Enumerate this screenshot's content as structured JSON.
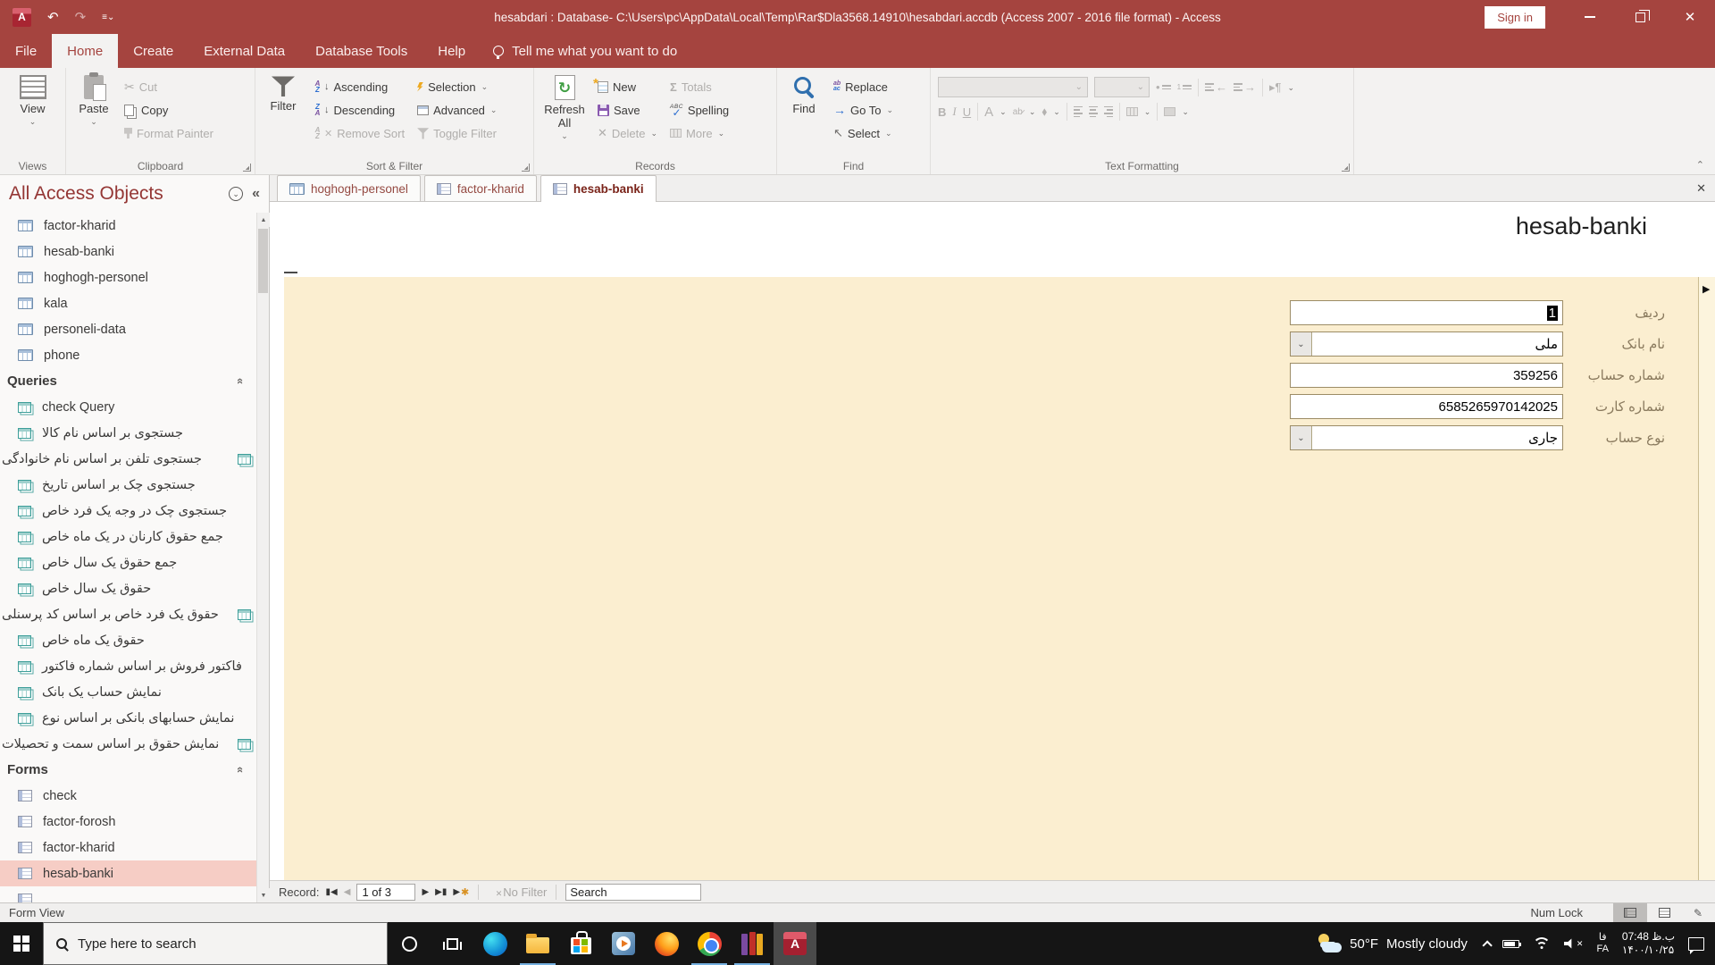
{
  "titlebar": {
    "title": "hesabdari : Database- C:\\Users\\pc\\AppData\\Local\\Temp\\Rar$Dla3568.14910\\hesabdari.accdb (Access 2007 - 2016 file format)  -  Access",
    "sign_in": "Sign in"
  },
  "menubar": {
    "file": "File",
    "home": "Home",
    "create": "Create",
    "external_data": "External Data",
    "database_tools": "Database Tools",
    "help": "Help",
    "tell_me": "Tell me what you want to do"
  },
  "ribbon": {
    "view": "View",
    "paste": "Paste",
    "cut": "Cut",
    "copy": "Copy",
    "format_painter": "Format Painter",
    "filter": "Filter",
    "ascending": "Ascending",
    "descending": "Descending",
    "remove_sort": "Remove Sort",
    "selection": "Selection",
    "advanced": "Advanced",
    "toggle_filter": "Toggle Filter",
    "refresh_all": "Refresh All",
    "new": "New",
    "save": "Save",
    "delete": "Delete",
    "totals": "Totals",
    "spelling": "Spelling",
    "more": "More",
    "find": "Find",
    "replace": "Replace",
    "go_to": "Go To",
    "select": "Select",
    "groups": {
      "views": "Views",
      "clipboard": "Clipboard",
      "sort_filter": "Sort & Filter",
      "records": "Records",
      "find": "Find",
      "text_formatting": "Text Formatting"
    }
  },
  "nav": {
    "header": "All Access Objects",
    "tables": [
      "factor-kharid",
      "hesab-banki",
      "hoghogh-personel",
      "kala",
      "personeli-data",
      "phone"
    ],
    "queries_label": "Queries",
    "queries": [
      "check Query",
      "جستجوی بر اساس نام کالا",
      "جستجوی تلفن بر اساس نام خانوادگی",
      "جستجوی چک بر اساس تاریخ",
      "جستجوی چک در وجه یک فرد خاص",
      "جمع حقوق کارنان در یک ماه خاص",
      "جمع حقوق یک سال خاص",
      "حقوق یک سال خاص",
      "حقوق یک فرد خاص بر اساس کد پرسنلی",
      "حقوق یک ماه خاص",
      "فاکتور فروش بر اساس شماره فاکتور",
      "نمایش حساب یک بانک",
      "نمایش حسابهای بانکی بر اساس نوع",
      "نمایش حقوق بر اساس سمت و تحصیلات"
    ],
    "forms_label": "Forms",
    "forms": [
      "check",
      "factor-forosh",
      "factor-kharid",
      "hesab-banki"
    ]
  },
  "doc_tabs": {
    "tab1": "hoghogh-personel",
    "tab2": "factor-kharid",
    "tab3": "hesab-banki"
  },
  "form": {
    "title": "hesab-banki",
    "rows": [
      {
        "label": "ردیف",
        "value": "1"
      },
      {
        "label": "نام بانک",
        "value": "ملی"
      },
      {
        "label": "شماره حساب",
        "value": "359256"
      },
      {
        "label": "شماره کارت",
        "value": "6585265970142025"
      },
      {
        "label": "نوع حساب",
        "value": "جاری"
      }
    ]
  },
  "record_nav": {
    "label": "Record:",
    "position": "1 of 3",
    "no_filter": "No Filter",
    "search": "Search"
  },
  "status_bar": {
    "view_mode": "Form View",
    "num_lock": "Num Lock"
  },
  "taskbar": {
    "search_placeholder": "Type here to search",
    "weather_temp": "50°F",
    "weather_desc": "Mostly cloudy",
    "lang_primary": "فا",
    "lang_secondary": "FA",
    "time": "ب.ظ 07:48",
    "date": "۱۴۰۰/۱۰/۲۵"
  },
  "colors": {
    "accent_red": "#a5443f",
    "form_background": "#fbeed0",
    "selection_pink": "#f6cdc5"
  }
}
